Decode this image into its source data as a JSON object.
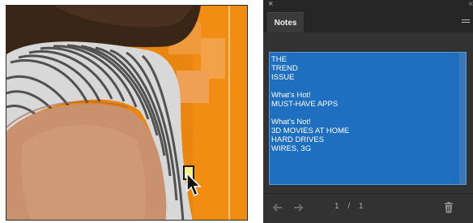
{
  "canvas": {
    "description_icons": [
      "note-marker",
      "arrow-cursor-icon"
    ]
  },
  "notes_panel": {
    "close_label": "×",
    "collapse_label": "«",
    "tab_label": "Notes",
    "note_lines": [
      "THE",
      "TREND",
      "ISSUE",
      "",
      "What's Hot!",
      "MUST-HAVE APPS",
      "",
      "What's Not!",
      "3D MOVIES AT HOME",
      "HARD DRIVES",
      "WIRES, 3G"
    ],
    "page_counter": "1 / 1",
    "icons": [
      "prev-arrow-icon",
      "next-arrow-icon",
      "trash-icon",
      "panel-menu-icon"
    ]
  },
  "colors": {
    "panel_bg": "#323232",
    "note_highlight": "#1e6fc0",
    "canvas_orange": "#e9860f"
  }
}
